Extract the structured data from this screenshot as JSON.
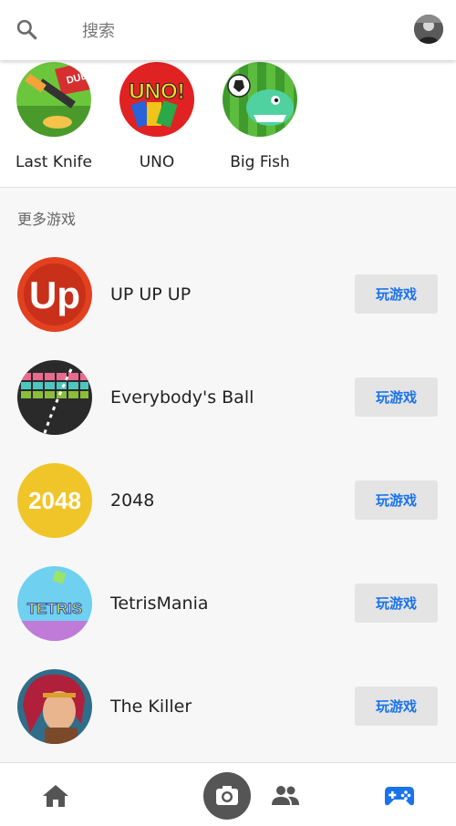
{
  "header": {
    "search_placeholder": "搜索"
  },
  "recent_games": [
    {
      "name": "Last Knife"
    },
    {
      "name": "UNO"
    },
    {
      "name": "Big Fish"
    }
  ],
  "section_title": "更多游戏",
  "games": [
    {
      "title": "UP UP UP",
      "button": "玩游戏"
    },
    {
      "title": "Everybody's Ball",
      "button": "玩游戏"
    },
    {
      "title": "2048",
      "button": "玩游戏"
    },
    {
      "title": "TetrisMania",
      "button": "玩游戏"
    },
    {
      "title": "The Killer",
      "button": "玩游戏"
    }
  ],
  "thumb_texts": {
    "duel": "DUEL",
    "uno": "UNO!",
    "up": "Up",
    "n2048": "2048",
    "tetris": "TETRIS"
  },
  "colors": {
    "accent": "#1a73e8",
    "nav_active": "#1a73e8",
    "nav_inactive": "#555555"
  }
}
